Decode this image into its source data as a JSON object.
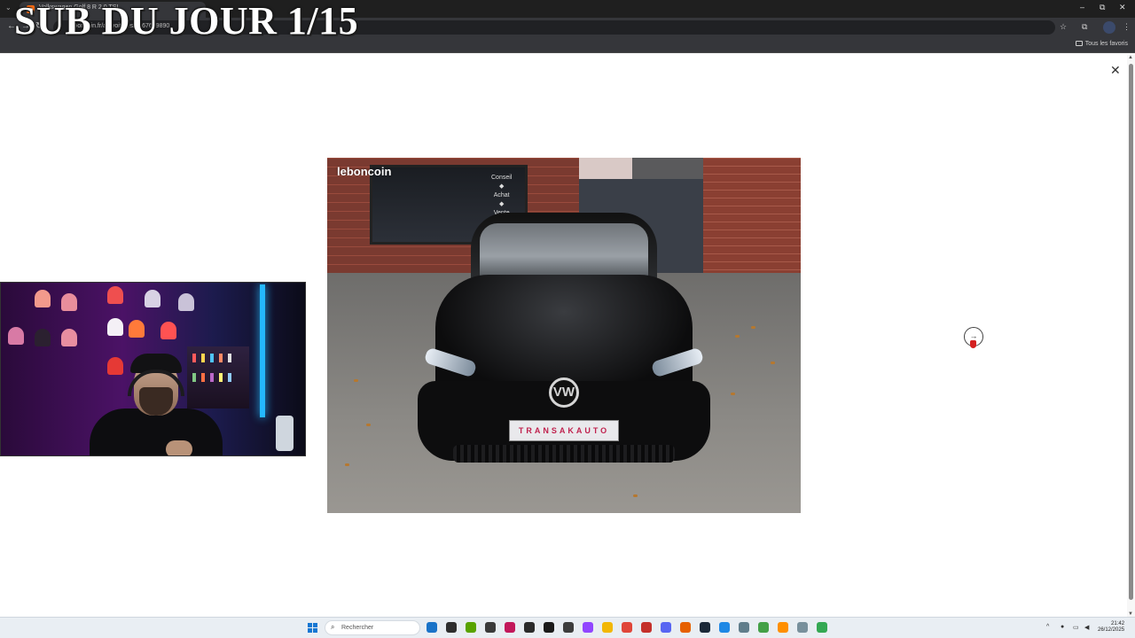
{
  "overlay": {
    "title": "SUB DU JOUR 1/15"
  },
  "browser": {
    "tab_title": "Volkswagen Golf 8 R 2.0 TSI",
    "url": "leboncoin.fr/ad/voitures/3067679890",
    "bookmarks_all": "Tous les favoris",
    "window_minimize": "–",
    "window_restore": "⧉",
    "window_close": "✕"
  },
  "viewer": {
    "close_label": "✕",
    "next_label": "→",
    "photo_watermark": "leboncoin",
    "shop_sign": [
      "Conseil",
      "◆",
      "Achat",
      "◆",
      "Vente"
    ],
    "plate_text": "TRANSAKAUTO",
    "badge_text": "VW"
  },
  "taskbar": {
    "search_placeholder": "Rechercher",
    "time": "21:42",
    "date": "26/12/2025",
    "apps": [
      {
        "icon": "file-explorer-icon",
        "color": "#1a73c8"
      },
      {
        "icon": "settings-app-icon",
        "color": "#2e2e2e"
      },
      {
        "icon": "nvidia-icon",
        "color": "#59a300"
      },
      {
        "icon": "app-icon",
        "color": "#3a3a3a"
      },
      {
        "icon": "affinity-icon",
        "color": "#c2185b"
      },
      {
        "icon": "dashboard-icon",
        "color": "#2b2b2b"
      },
      {
        "icon": "app-icon",
        "color": "#1b1b1b"
      },
      {
        "icon": "obs-icon",
        "color": "#3d3d3d"
      },
      {
        "icon": "twitch-icon",
        "color": "#9146ff"
      },
      {
        "icon": "folder-icon",
        "color": "#f2b705"
      },
      {
        "icon": "chrome-icon",
        "color": "#e0463a"
      },
      {
        "icon": "app-icon",
        "color": "#c4302b"
      },
      {
        "icon": "discord-icon",
        "color": "#5865f2"
      },
      {
        "icon": "firefox-icon",
        "color": "#e66000"
      },
      {
        "icon": "steam-icon",
        "color": "#1b2838"
      },
      {
        "icon": "app-icon",
        "color": "#1e88e5"
      },
      {
        "icon": "app-icon",
        "color": "#607d8b"
      },
      {
        "icon": "app-icon",
        "color": "#43a047"
      },
      {
        "icon": "app-icon",
        "color": "#ff8f00"
      },
      {
        "icon": "app-icon",
        "color": "#78909c"
      },
      {
        "icon": "chrome-active-icon",
        "color": "#34a853"
      }
    ]
  }
}
